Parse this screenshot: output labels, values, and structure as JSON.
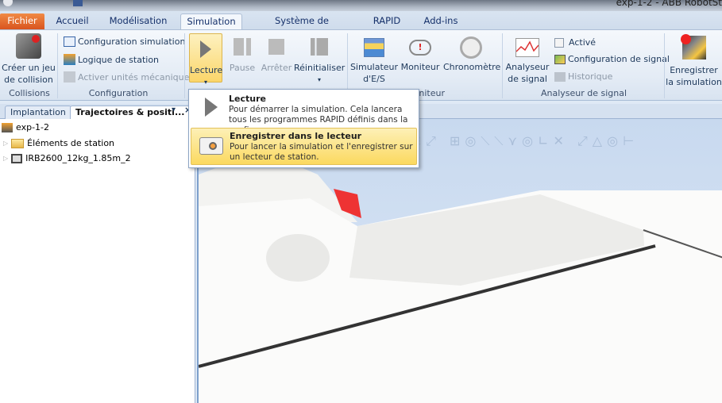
{
  "window": {
    "title": "exp-1-2 - ABB RobotSt"
  },
  "tabs": [
    "Fichier",
    "Accueil",
    "Modélisation",
    "Simulation",
    "Système de commande",
    "RAPID",
    "Add-ins"
  ],
  "ribbon": {
    "collisions": {
      "create": "Créer un jeu de collision",
      "create_l1": "Créer un jeu",
      "create_l2": "de collision",
      "group": "Collisions"
    },
    "configuration": {
      "sim_config": "Configuration simulation",
      "station_logic": "Logique de station",
      "activate_units": "Activer unités mécaniques",
      "group": "Configuration"
    },
    "control": {
      "play": "Lecture",
      "pause": "Pause",
      "stop": "Arrêter",
      "reset": "Réinitialiser"
    },
    "monitor": {
      "io_sim_l1": "Simulateur",
      "io_sim_l2": "d'E/S",
      "monitor": "Moniteur",
      "stopwatch": "Chronomètre",
      "group": "Moniteur",
      "group_visible": "niteur"
    },
    "signal": {
      "analyzer_l1": "Analyseur",
      "analyzer_l2": "de signal",
      "enabled": "Activé",
      "signal_config": "Configuration de signal",
      "history": "Historique",
      "group": "Analyseur de signal"
    },
    "record": {
      "l1": "Enregistrer",
      "l2": "la simulation"
    }
  },
  "panel": {
    "tabs": [
      "Implantation",
      "Trajectoires & positi..."
    ],
    "tree": [
      {
        "label": "exp-1-2"
      },
      {
        "label": "Éléments de station"
      },
      {
        "label": "IRB2600_12kg_1.85m_2"
      }
    ]
  },
  "menu": {
    "items": [
      {
        "title": "Lecture",
        "desc": "Pour démarrer la simulation. Cela lancera tous les programmes RAPID définis dans la configu..."
      },
      {
        "title": "Enregistrer dans le lecteur",
        "desc": "Pour lancer la simulation et l'enregistrer sur un lecteur de station."
      }
    ]
  },
  "colors": {
    "file_tab": "#e06b2c",
    "highlight": "#fbd95f",
    "accent": "#1e395b"
  }
}
